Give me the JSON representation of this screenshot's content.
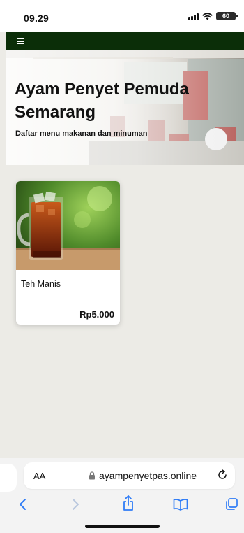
{
  "status_bar": {
    "time": "09.29",
    "battery": "60",
    "icons": [
      "signal-icon",
      "wifi-icon",
      "battery-icon"
    ]
  },
  "navbar": {
    "menu_icon": "hamburger-icon",
    "background_color": "#0b2e08"
  },
  "hero": {
    "title": "Ayam Penyet Pemuda Semarang",
    "subtitle": "Daftar menu makanan dan minuman"
  },
  "menu": {
    "items": [
      {
        "name": "Teh Manis",
        "price": "Rp5.000",
        "image": "iced-tea-glass"
      }
    ]
  },
  "browser": {
    "text_size_button": "AA",
    "url": "ayampenyetpas.online",
    "icons": [
      "lock-icon",
      "reload-icon",
      "back-icon",
      "forward-icon",
      "share-icon",
      "bookmarks-icon",
      "tabs-icon"
    ]
  }
}
